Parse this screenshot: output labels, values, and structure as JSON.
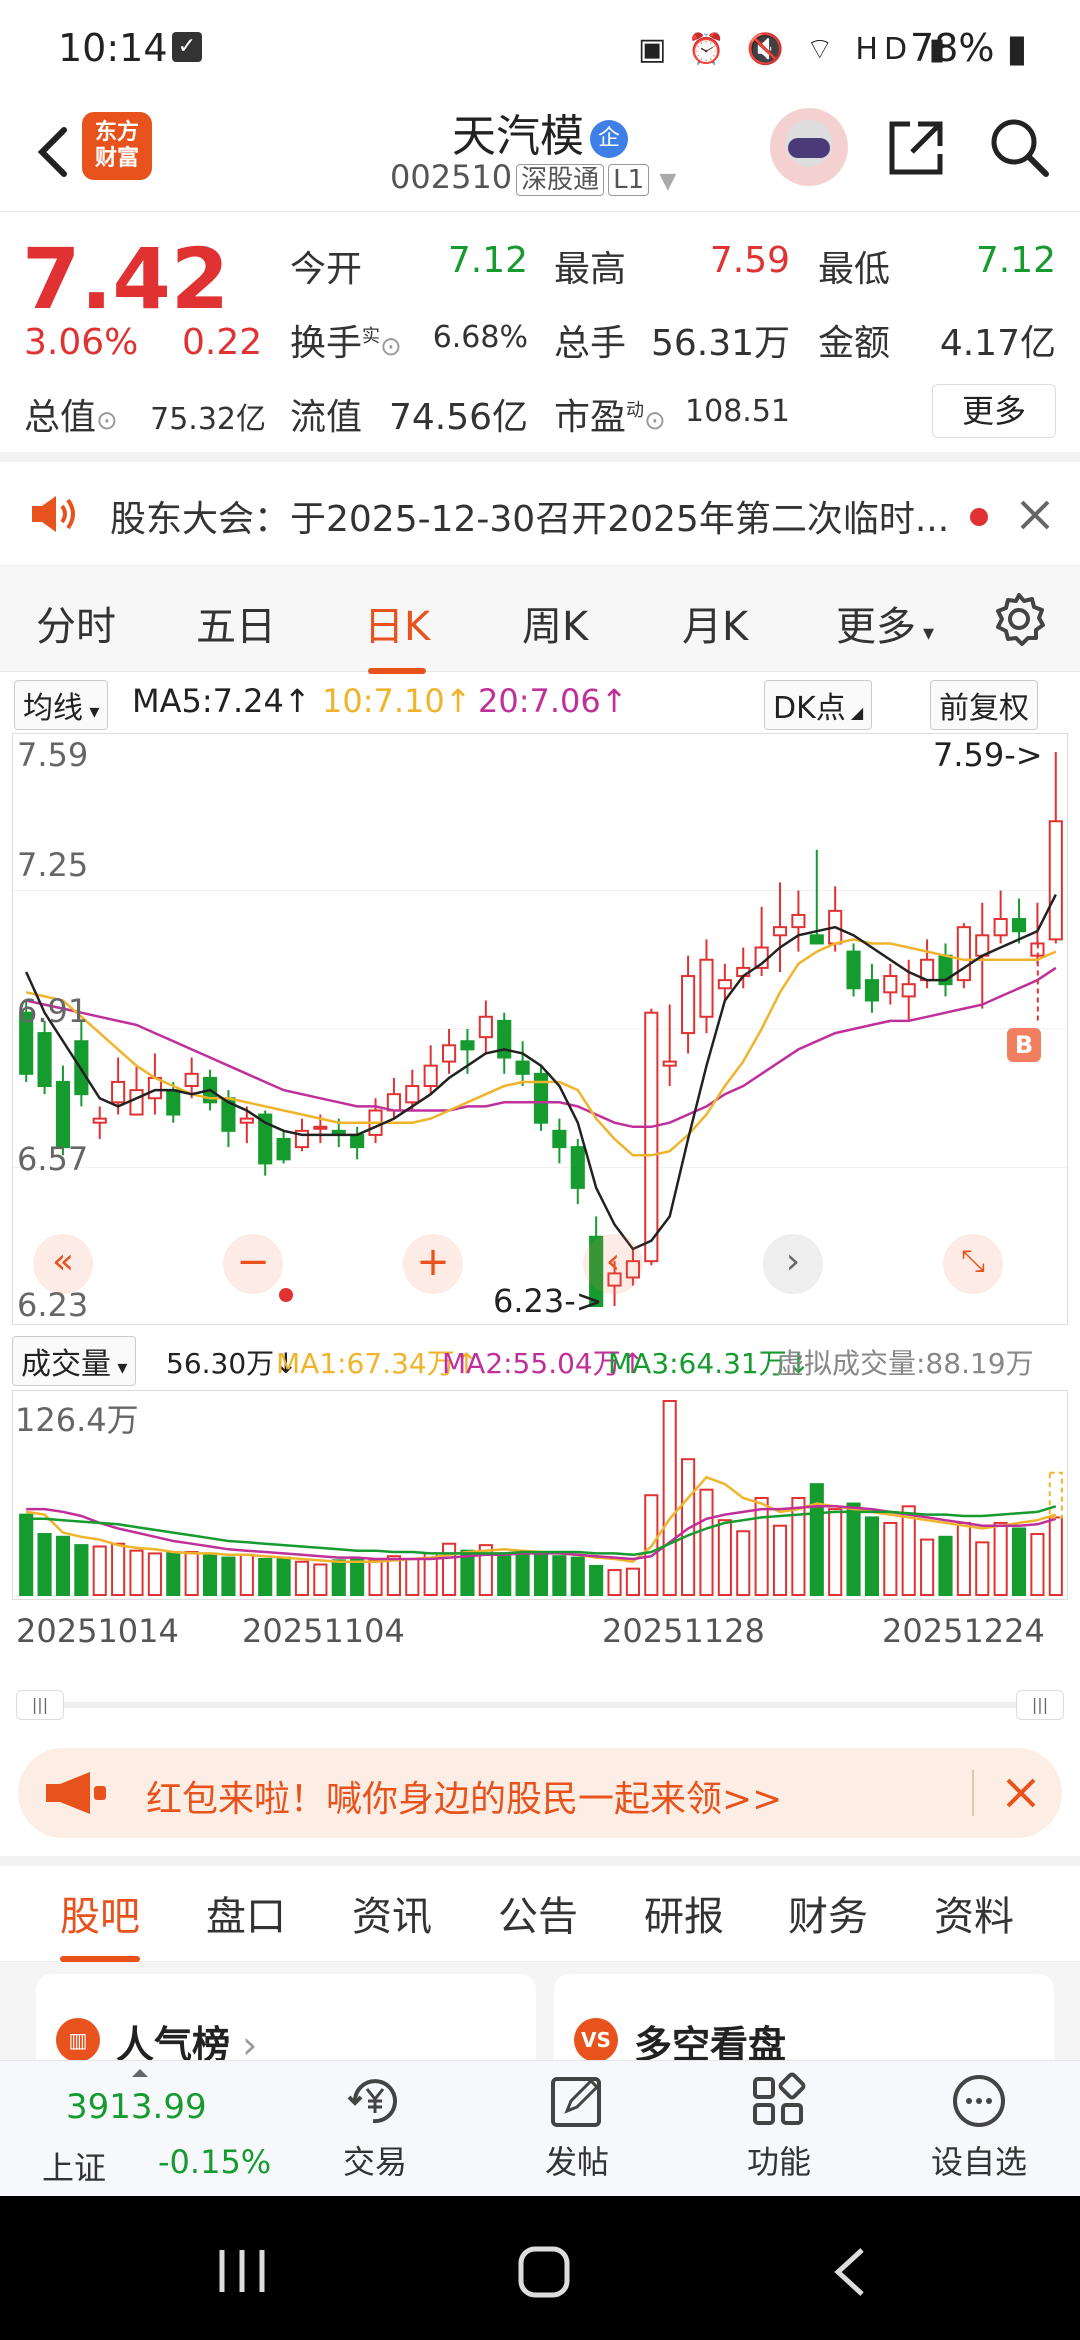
{
  "status": {
    "time": "10:14",
    "battery": "78%"
  },
  "header": {
    "logo_line1": "东方",
    "logo_line2": "财富",
    "name": "天汽模",
    "badge": "企",
    "code": "002510",
    "market_tag": "深股通",
    "level_tag": "L1"
  },
  "quote": {
    "price": "7.42",
    "pct": "3.06%",
    "change": "0.22",
    "open_label": "今开",
    "open": "7.12",
    "high_label": "最高",
    "high": "7.59",
    "low_label": "最低",
    "low": "7.12",
    "turnover_label": "换手",
    "turnover_sup": "实",
    "turnover": "6.68%",
    "volume_label": "总手",
    "volume": "56.31万",
    "amount_label": "金额",
    "amount": "4.17亿",
    "mktcap_label": "总值",
    "mktcap": "75.32亿",
    "float_label": "流值",
    "float": "74.56亿",
    "pe_label": "市盈",
    "pe_sup": "动",
    "pe": "108.51",
    "more": "更多"
  },
  "notice": {
    "text": "股东大会：于2025-12-30召开2025年第二次临时..."
  },
  "ktabs": [
    {
      "label": "分时"
    },
    {
      "label": "五日"
    },
    {
      "label": "日K"
    },
    {
      "label": "周K"
    },
    {
      "label": "月K"
    },
    {
      "label": "更多"
    }
  ],
  "ma": {
    "selector": "均线",
    "ma5": "MA5:7.24",
    "ma10": "10:7.10",
    "ma20": "20:7.06",
    "dk": "DK点",
    "adjust": "前复权"
  },
  "chart_labels": {
    "y1": "7.59",
    "y2": "7.25",
    "y3": "6.91",
    "y4": "6.57",
    "y5": "6.23",
    "high_marker": "7.59->",
    "low_marker": "6.23->",
    "b_marker": "B"
  },
  "volume": {
    "selector": "成交量",
    "vol": "56.30万",
    "ma1": "MA1:67.34万",
    "ma2": "MA2:55.04万",
    "ma3": "MA3:64.31万",
    "virtual": "虚拟成交量:88.19万",
    "ymax": "126.4万"
  },
  "dates": [
    "20251014",
    "20251104",
    "20251128",
    "20251224"
  ],
  "banner": {
    "text": "红包来啦！喊你身边的股民一起来领>>"
  },
  "subtabs": [
    {
      "label": "股吧"
    },
    {
      "label": "盘口"
    },
    {
      "label": "资讯"
    },
    {
      "label": "公告"
    },
    {
      "label": "研报"
    },
    {
      "label": "财务"
    },
    {
      "label": "资料"
    }
  ],
  "cards": {
    "left": "人气榜",
    "right": "多空看盘",
    "right_icon": "VS"
  },
  "bottom": {
    "index_value": "3913.99",
    "index_name": "上证",
    "index_pct": "-0.15%",
    "trade": "交易",
    "post": "发帖",
    "func": "功能",
    "watch": "设自选"
  },
  "colors": {
    "up": "#e03232",
    "down": "#169b2f",
    "accent": "#e8521d"
  },
  "chart_data": {
    "type": "candlestick",
    "ylim": [
      6.23,
      7.59
    ],
    "candles": [
      [
        6.95,
        6.8,
        6.98,
        6.78
      ],
      [
        6.9,
        6.77,
        6.93,
        6.75
      ],
      [
        6.78,
        6.62,
        6.82,
        6.6
      ],
      [
        6.88,
        6.75,
        6.93,
        6.72
      ],
      [
        6.68,
        6.69,
        6.72,
        6.64
      ],
      [
        6.73,
        6.78,
        6.84,
        6.7
      ],
      [
        6.7,
        6.76,
        6.82,
        6.7
      ],
      [
        6.74,
        6.79,
        6.85,
        6.7
      ],
      [
        6.76,
        6.7,
        6.78,
        6.68
      ],
      [
        6.77,
        6.8,
        6.84,
        6.74
      ],
      [
        6.79,
        6.73,
        6.81,
        6.71
      ],
      [
        6.74,
        6.66,
        6.76,
        6.62
      ],
      [
        6.68,
        6.69,
        6.72,
        6.63
      ],
      [
        6.7,
        6.58,
        6.71,
        6.55
      ],
      [
        6.64,
        6.59,
        6.66,
        6.58
      ],
      [
        6.62,
        6.66,
        6.69,
        6.61
      ],
      [
        6.67,
        6.67,
        6.7,
        6.63
      ],
      [
        6.66,
        6.65,
        6.69,
        6.62
      ],
      [
        6.65,
        6.62,
        6.67,
        6.59
      ],
      [
        6.65,
        6.71,
        6.74,
        6.63
      ],
      [
        6.71,
        6.75,
        6.79,
        6.69
      ],
      [
        6.73,
        6.77,
        6.81,
        6.71
      ],
      [
        6.77,
        6.82,
        6.87,
        6.75
      ],
      [
        6.83,
        6.87,
        6.91,
        6.8
      ],
      [
        6.88,
        6.86,
        6.91,
        6.8
      ],
      [
        6.89,
        6.94,
        6.98,
        6.85
      ],
      [
        6.93,
        6.84,
        6.95,
        6.8
      ],
      [
        6.83,
        6.8,
        6.88,
        6.77
      ],
      [
        6.8,
        6.68,
        6.82,
        6.66
      ],
      [
        6.66,
        6.62,
        6.69,
        6.58
      ],
      [
        6.62,
        6.52,
        6.64,
        6.48
      ],
      [
        6.4,
        6.23,
        6.45,
        6.23
      ],
      [
        6.28,
        6.31,
        6.34,
        6.23
      ],
      [
        6.3,
        6.34,
        6.37,
        6.28
      ],
      [
        6.34,
        6.95,
        6.96,
        6.33
      ],
      [
        6.82,
        6.83,
        6.97,
        6.77
      ],
      [
        6.9,
        7.04,
        7.09,
        6.85
      ],
      [
        6.94,
        7.08,
        7.13,
        6.9
      ],
      [
        7.01,
        7.03,
        7.07,
        6.98
      ],
      [
        7.04,
        7.06,
        7.11,
        7.01
      ],
      [
        7.06,
        7.11,
        7.21,
        7.04
      ],
      [
        7.14,
        7.16,
        7.27,
        7.05
      ],
      [
        7.16,
        7.19,
        7.25,
        7.1
      ],
      [
        7.14,
        7.12,
        7.35,
        7.12
      ],
      [
        7.12,
        7.2,
        7.26,
        7.1
      ],
      [
        7.1,
        7.01,
        7.12,
        6.99
      ],
      [
        7.03,
        6.98,
        7.07,
        6.95
      ],
      [
        7.0,
        7.04,
        7.07,
        6.97
      ],
      [
        6.99,
        7.02,
        7.08,
        6.93
      ],
      [
        7.03,
        7.08,
        7.13,
        7.01
      ],
      [
        7.09,
        7.02,
        7.12,
        6.99
      ],
      [
        7.03,
        7.16,
        7.17,
        7.01
      ],
      [
        7.09,
        7.14,
        7.22,
        6.96
      ],
      [
        7.14,
        7.18,
        7.25,
        7.12
      ],
      [
        7.18,
        7.15,
        7.23,
        7.12
      ],
      [
        7.09,
        7.12,
        7.22,
        7.07
      ],
      [
        7.13,
        7.42,
        7.59,
        7.12
      ]
    ],
    "ma5": [
      7.05,
      6.95,
      6.88,
      6.81,
      6.74,
      6.72,
      6.74,
      6.76,
      6.76,
      6.75,
      6.76,
      6.73,
      6.71,
      6.68,
      6.66,
      6.65,
      6.65,
      6.65,
      6.65,
      6.67,
      6.69,
      6.72,
      6.75,
      6.79,
      6.82,
      6.85,
      6.86,
      6.85,
      6.82,
      6.77,
      6.68,
      6.52,
      6.43,
      6.37,
      6.39,
      6.45,
      6.64,
      6.82,
      6.98,
      7.04,
      7.07,
      7.11,
      7.14,
      7.15,
      7.16,
      7.14,
      7.11,
      7.08,
      7.05,
      7.03,
      7.03,
      7.06,
      7.09,
      7.11,
      7.13,
      7.15,
      7.24
    ],
    "ma10": [
      7.0,
      6.99,
      6.98,
      6.94,
      6.9,
      6.86,
      6.82,
      6.79,
      6.77,
      6.75,
      6.74,
      6.74,
      6.73,
      6.72,
      6.71,
      6.7,
      6.69,
      6.68,
      6.68,
      6.68,
      6.68,
      6.68,
      6.69,
      6.71,
      6.73,
      6.75,
      6.77,
      6.78,
      6.78,
      6.78,
      6.76,
      6.69,
      6.64,
      6.6,
      6.6,
      6.61,
      6.65,
      6.7,
      6.77,
      6.83,
      6.91,
      7.0,
      7.07,
      7.1,
      7.12,
      7.13,
      7.12,
      7.12,
      7.11,
      7.1,
      7.09,
      7.08,
      7.08,
      7.08,
      7.08,
      7.08,
      7.1
    ],
    "ma20": [
      6.98,
      6.97,
      6.96,
      6.95,
      6.94,
      6.93,
      6.92,
      6.9,
      6.88,
      6.86,
      6.84,
      6.82,
      6.8,
      6.78,
      6.76,
      6.75,
      6.74,
      6.73,
      6.72,
      6.72,
      6.71,
      6.71,
      6.71,
      6.71,
      6.72,
      6.72,
      6.73,
      6.73,
      6.73,
      6.73,
      6.72,
      6.7,
      6.68,
      6.67,
      6.67,
      6.68,
      6.7,
      6.72,
      6.75,
      6.77,
      6.8,
      6.83,
      6.86,
      6.88,
      6.9,
      6.91,
      6.92,
      6.93,
      6.93,
      6.94,
      6.95,
      6.96,
      6.97,
      6.99,
      7.01,
      7.03,
      7.06
    ],
    "volumes": [
      58,
      44,
      42,
      36,
      35,
      37,
      32,
      30,
      31,
      31,
      30,
      27,
      29,
      26,
      27,
      24,
      22,
      25,
      26,
      25,
      28,
      26,
      30,
      37,
      32,
      36,
      30,
      30,
      31,
      28,
      27,
      21,
      18,
      19,
      72,
      140,
      98,
      76,
      54,
      46,
      70,
      50,
      70,
      80,
      62,
      66,
      56,
      52,
      64,
      40,
      42,
      52,
      38,
      52,
      48,
      44,
      56
    ],
    "vol_ma1": [
      60,
      58,
      45,
      42,
      40,
      36,
      34,
      33,
      31,
      30,
      30,
      29,
      29,
      28,
      27,
      26,
      25,
      24,
      24,
      24,
      25,
      26,
      27,
      29,
      31,
      32,
      33,
      32,
      31,
      30,
      29,
      27,
      26,
      24,
      35,
      55,
      70,
      85,
      80,
      70,
      66,
      60,
      62,
      66,
      64,
      62,
      60,
      58,
      56,
      54,
      52,
      50,
      48,
      50,
      52,
      54,
      58
    ],
    "vol_ma2": [
      62,
      62,
      60,
      57,
      52,
      48,
      45,
      42,
      39,
      37,
      35,
      33,
      32,
      31,
      30,
      29,
      28,
      27,
      27,
      26,
      26,
      26,
      26,
      27,
      28,
      29,
      29,
      30,
      30,
      30,
      29,
      28,
      27,
      26,
      28,
      38,
      48,
      55,
      58,
      60,
      62,
      62,
      63,
      64,
      64,
      63,
      62,
      60,
      58,
      56,
      54,
      52,
      50,
      50,
      50,
      51,
      55
    ],
    "vol_ma3": [
      55,
      55,
      54,
      53,
      52,
      51,
      49,
      47,
      45,
      43,
      41,
      39,
      38,
      37,
      36,
      35,
      34,
      33,
      32,
      32,
      31,
      31,
      30,
      30,
      30,
      30,
      30,
      31,
      31,
      31,
      31,
      30,
      30,
      29,
      31,
      37,
      43,
      48,
      52,
      54,
      56,
      57,
      58,
      59,
      60,
      60,
      60,
      60,
      59,
      58,
      58,
      57,
      57,
      58,
      59,
      60,
      64
    ]
  }
}
